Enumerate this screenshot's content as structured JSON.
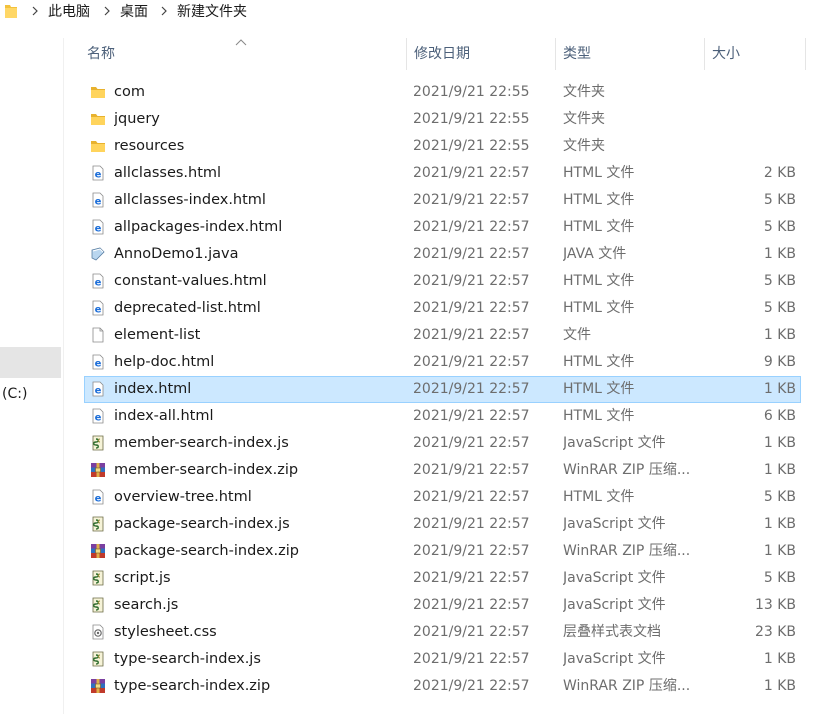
{
  "address_bar": {
    "breadcrumbs": [
      "此电脑",
      "桌面",
      "新建文件夹"
    ],
    "separator": ">"
  },
  "nav_pane": {
    "drive_label": "(C:)"
  },
  "columns": {
    "name": "名称",
    "date": "修改日期",
    "type": "类型",
    "size": "大小"
  },
  "sort": {
    "column": "name",
    "direction": "ascending"
  },
  "selected_index": 11,
  "colors": {
    "selection_bg": "#cce8ff",
    "selection_border": "#99d1ff",
    "header_text": "#4c607a",
    "folder": "#f3c23c",
    "ie_blue": "#1e6fd9"
  },
  "files": [
    {
      "name": "com",
      "date": "2021/9/21 22:55",
      "type": "文件夹",
      "size": "",
      "icon": "folder-icon"
    },
    {
      "name": "jquery",
      "date": "2021/9/21 22:55",
      "type": "文件夹",
      "size": "",
      "icon": "folder-icon"
    },
    {
      "name": "resources",
      "date": "2021/9/21 22:55",
      "type": "文件夹",
      "size": "",
      "icon": "folder-icon"
    },
    {
      "name": "allclasses.html",
      "date": "2021/9/21 22:57",
      "type": "HTML 文件",
      "size": "2 KB",
      "icon": "html-file-icon"
    },
    {
      "name": "allclasses-index.html",
      "date": "2021/9/21 22:57",
      "type": "HTML 文件",
      "size": "5 KB",
      "icon": "html-file-icon"
    },
    {
      "name": "allpackages-index.html",
      "date": "2021/9/21 22:57",
      "type": "HTML 文件",
      "size": "5 KB",
      "icon": "html-file-icon"
    },
    {
      "name": "AnnoDemo1.java",
      "date": "2021/9/21 22:57",
      "type": "JAVA 文件",
      "size": "1 KB",
      "icon": "java-file-icon"
    },
    {
      "name": "constant-values.html",
      "date": "2021/9/21 22:57",
      "type": "HTML 文件",
      "size": "5 KB",
      "icon": "html-file-icon"
    },
    {
      "name": "deprecated-list.html",
      "date": "2021/9/21 22:57",
      "type": "HTML 文件",
      "size": "5 KB",
      "icon": "html-file-icon"
    },
    {
      "name": "element-list",
      "date": "2021/9/21 22:57",
      "type": "文件",
      "size": "1 KB",
      "icon": "blank-file-icon"
    },
    {
      "name": "help-doc.html",
      "date": "2021/9/21 22:57",
      "type": "HTML 文件",
      "size": "9 KB",
      "icon": "html-file-icon"
    },
    {
      "name": "index.html",
      "date": "2021/9/21 22:57",
      "type": "HTML 文件",
      "size": "1 KB",
      "icon": "html-file-icon"
    },
    {
      "name": "index-all.html",
      "date": "2021/9/21 22:57",
      "type": "HTML 文件",
      "size": "6 KB",
      "icon": "html-file-icon"
    },
    {
      "name": "member-search-index.js",
      "date": "2021/9/21 22:57",
      "type": "JavaScript 文件",
      "size": "1 KB",
      "icon": "js-file-icon"
    },
    {
      "name": "member-search-index.zip",
      "date": "2021/9/21 22:57",
      "type": "WinRAR ZIP 压缩...",
      "size": "1 KB",
      "icon": "winrar-zip-icon"
    },
    {
      "name": "overview-tree.html",
      "date": "2021/9/21 22:57",
      "type": "HTML 文件",
      "size": "5 KB",
      "icon": "html-file-icon"
    },
    {
      "name": "package-search-index.js",
      "date": "2021/9/21 22:57",
      "type": "JavaScript 文件",
      "size": "1 KB",
      "icon": "js-file-icon"
    },
    {
      "name": "package-search-index.zip",
      "date": "2021/9/21 22:57",
      "type": "WinRAR ZIP 压缩...",
      "size": "1 KB",
      "icon": "winrar-zip-icon"
    },
    {
      "name": "script.js",
      "date": "2021/9/21 22:57",
      "type": "JavaScript 文件",
      "size": "5 KB",
      "icon": "js-file-icon"
    },
    {
      "name": "search.js",
      "date": "2021/9/21 22:57",
      "type": "JavaScript 文件",
      "size": "13 KB",
      "icon": "js-file-icon"
    },
    {
      "name": "stylesheet.css",
      "date": "2021/9/21 22:57",
      "type": "层叠样式表文档",
      "size": "23 KB",
      "icon": "css-file-icon"
    },
    {
      "name": "type-search-index.js",
      "date": "2021/9/21 22:57",
      "type": "JavaScript 文件",
      "size": "1 KB",
      "icon": "js-file-icon"
    },
    {
      "name": "type-search-index.zip",
      "date": "2021/9/21 22:57",
      "type": "WinRAR ZIP 压缩...",
      "size": "1 KB",
      "icon": "winrar-zip-icon"
    }
  ]
}
